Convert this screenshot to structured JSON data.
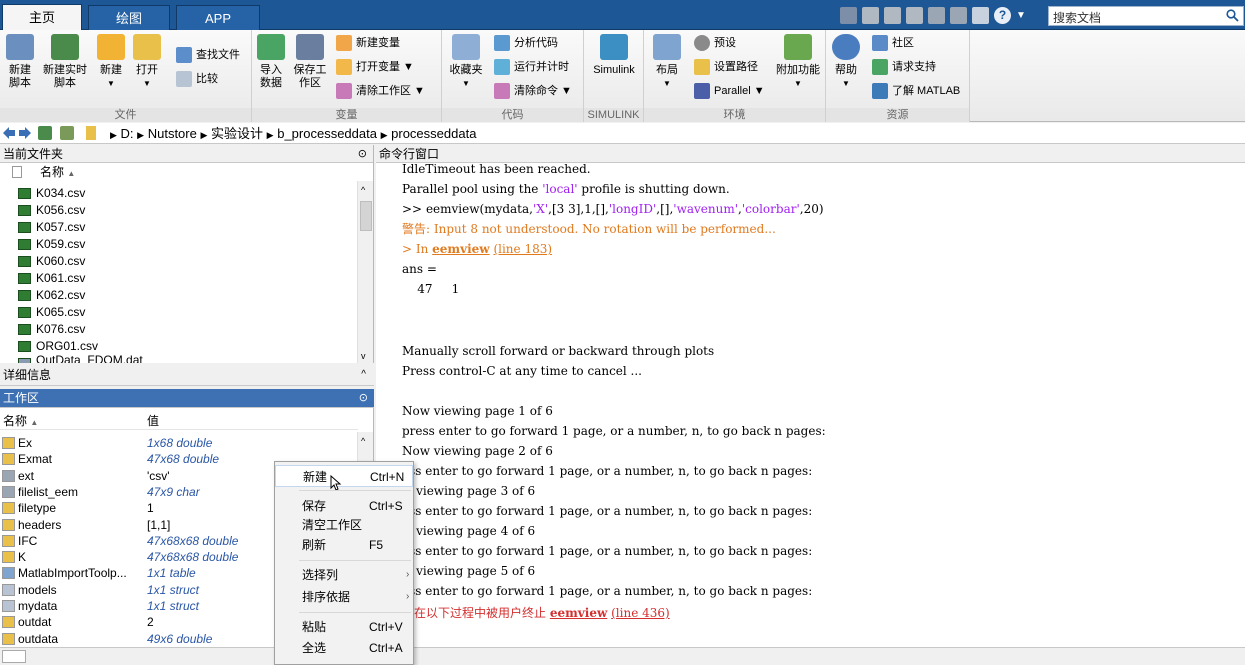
{
  "tabs": [
    {
      "label": "主页",
      "active": true
    },
    {
      "label": "绘图",
      "active": false
    },
    {
      "label": "APP",
      "active": false
    }
  ],
  "search": {
    "placeholder": "搜索文档"
  },
  "ribbon": {
    "file": {
      "label": "文件",
      "new_script": "新建脚本",
      "new_live": "新建实时脚本",
      "new": "新建",
      "open": "打开",
      "find": "查找文件",
      "compare": "比较"
    },
    "variable": {
      "label": "变量",
      "import": "导入数据",
      "save": "保存工作区",
      "new_var": "新建变量",
      "open_var": "打开变量",
      "clear_ws": "清除工作区"
    },
    "code": {
      "label": "代码",
      "favorites": "收藏夹",
      "analyze": "分析代码",
      "run_time": "运行并计时",
      "clear_cmd": "清除命令"
    },
    "simulink": {
      "label": "SIMULINK",
      "btn": "Simulink"
    },
    "env": {
      "label": "环境",
      "layout": "布局",
      "prefs": "预设",
      "setpath": "设置路径",
      "parallel": "Parallel",
      "addons": "附加功能"
    },
    "resources": {
      "label": "资源",
      "help": "帮助",
      "community": "社区",
      "support": "请求支持",
      "learn": "了解 MATLAB"
    }
  },
  "address": {
    "parts": [
      "D:",
      "Nutstore",
      "实验设计",
      "b_processeddata",
      "processeddata"
    ]
  },
  "current_folder": {
    "title": "当前文件夹",
    "col_name": "名称",
    "files": [
      "K034.csv",
      "K056.csv",
      "K057.csv",
      "K059.csv",
      "K060.csv",
      "K061.csv",
      "K062.csv",
      "K065.csv",
      "K076.csv",
      "ORG01.csv",
      "OutData_FDOM.dat"
    ]
  },
  "details": {
    "title": "详细信息"
  },
  "workspace": {
    "title": "工作区",
    "col_name": "名称",
    "col_value": "值",
    "vars": [
      {
        "name": "Ex",
        "value": "1x68 double",
        "italic": true,
        "icon": "matrix"
      },
      {
        "name": "Exmat",
        "value": "47x68 double",
        "italic": true,
        "icon": "matrix"
      },
      {
        "name": "ext",
        "value": "'csv'",
        "italic": false,
        "icon": "char"
      },
      {
        "name": "filelist_eem",
        "value": "47x9 char",
        "italic": true,
        "icon": "char"
      },
      {
        "name": "filetype",
        "value": "1",
        "italic": false,
        "icon": "matrix"
      },
      {
        "name": "headers",
        "value": "[1,1]",
        "italic": false,
        "icon": "matrix"
      },
      {
        "name": "IFC",
        "value": "47x68x68 double",
        "italic": true,
        "icon": "matrix"
      },
      {
        "name": "K",
        "value": "47x68x68 double",
        "italic": true,
        "icon": "matrix"
      },
      {
        "name": "MatlabImportToolp...",
        "value": "1x1 table",
        "italic": true,
        "icon": "table"
      },
      {
        "name": "models",
        "value": "1x1 struct",
        "italic": true,
        "icon": "struct"
      },
      {
        "name": "mydata",
        "value": "1x1 struct",
        "italic": true,
        "icon": "struct"
      },
      {
        "name": "outdat",
        "value": "2",
        "italic": false,
        "icon": "matrix"
      },
      {
        "name": "outdata",
        "value": "49x6 double",
        "italic": true,
        "icon": "matrix"
      }
    ]
  },
  "command_window": {
    "title": "命令行窗口",
    "line1": "IdleTimeout has been reached.",
    "line2a": "Parallel pool using the ",
    "line2b": "'local'",
    "line2c": " profile is shutting down.",
    "line3_prompt": ">> ",
    "line3_a": "eemview(mydata,",
    "line3_s1": "'X'",
    "line3_b": ",[3 3],1,[],",
    "line3_s2": "'longID'",
    "line3_c": ",[],",
    "line3_s3": "'wavenum'",
    "line3_d": ",",
    "line3_s4": "'colorbar'",
    "line3_e": ",20)",
    "warn1": "警告: Input 8 not understood. No rotation will be performed...",
    "warn2_a": "> In ",
    "warn2_link": "eemview",
    "warn2_b": " ",
    "warn2_line": "(line 183)",
    "ans": "ans =",
    "ans_vals": "    47     1",
    "manual": "Manually scroll forward or backward through plots",
    "press_ctrl": "Press control-C at any time to cancel ...",
    "page1": "Now viewing page 1 of 6",
    "press1": "press enter to go forward 1 page, or a number, n, to go back n pages:",
    "page2": "Now viewing page 2 of 6",
    "press2": "ess enter to go forward 1 page, or a number, n, to go back n pages:",
    "page3": "w viewing page 3 of 6",
    "press3": "ess enter to go forward 1 page, or a number, n, to go back n pages:",
    "page4": "w viewing page 4 of 6",
    "press4": "ess enter to go forward 1 page, or a number, n, to go back n pages:",
    "page5": "w viewing page 5 of 6",
    "press5": "ess enter to go forward 1 page, or a number, n, to go back n pages:",
    "err_a": "作在以下过程中被用户终止 ",
    "err_link": "eemview",
    "err_b": " ",
    "err_line": "(line 436)"
  },
  "context_menu": {
    "new": "新建",
    "new_sc": "Ctrl+N",
    "save": "保存",
    "save_sc": "Ctrl+S",
    "clear": "清空工作区",
    "refresh": "刷新",
    "refresh_sc": "F5",
    "choose_cols": "选择列",
    "sort_by": "排序依据",
    "paste": "粘贴",
    "paste_sc": "Ctrl+V",
    "select_all": "全选",
    "select_all_sc": "Ctrl+A"
  },
  "colors": {
    "tabbar": "#1e5795",
    "panel_active": "#3e71b3",
    "warning": "#e07a1f",
    "error": "#d32f2f",
    "string": "#a020f0"
  }
}
